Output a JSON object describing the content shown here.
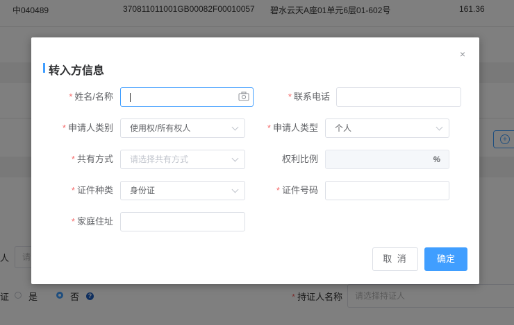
{
  "background": {
    "row": {
      "code": "中040489",
      "cert_no": "370811011001GB00082F00010057",
      "address": "碧水云天A座01单元6层01-602号",
      "area": "161.36"
    },
    "partial_label_left": "人",
    "partial_input_placeholder": "请",
    "cert_label_partial": "证",
    "radio_yes": "是",
    "radio_no": "否",
    "help_icon": "?",
    "holder_name_label": "持证人名称",
    "holder_name_placeholder": "请选择持证人",
    "add_icon": "+"
  },
  "dialog": {
    "title": "转入方信息",
    "close": "×",
    "fields": {
      "name": {
        "label": "姓名/名称",
        "value": ""
      },
      "phone": {
        "label": "联系电话",
        "value": ""
      },
      "applicant_category": {
        "label": "申请人类别",
        "value": "使用权/所有权人"
      },
      "applicant_type": {
        "label": "申请人类型",
        "value": "个人"
      },
      "share_mode": {
        "label": "共有方式",
        "placeholder": "请选择共有方式"
      },
      "right_ratio": {
        "label": "权利比例",
        "unit": "%"
      },
      "id_type": {
        "label": "证件种类",
        "value": "身份证"
      },
      "id_number": {
        "label": "证件号码",
        "value": ""
      },
      "home_address": {
        "label": "家庭住址",
        "value": ""
      }
    },
    "buttons": {
      "cancel": "取 消",
      "confirm": "确定"
    }
  },
  "colors": {
    "primary": "#409eff",
    "required": "#f56c6c",
    "overlay": "rgba(0,0,0,0.5)"
  },
  "icons": [
    "close-icon",
    "camera-icon",
    "chevron-down-icon",
    "percent-icon",
    "add-circle-icon",
    "help-icon"
  ]
}
